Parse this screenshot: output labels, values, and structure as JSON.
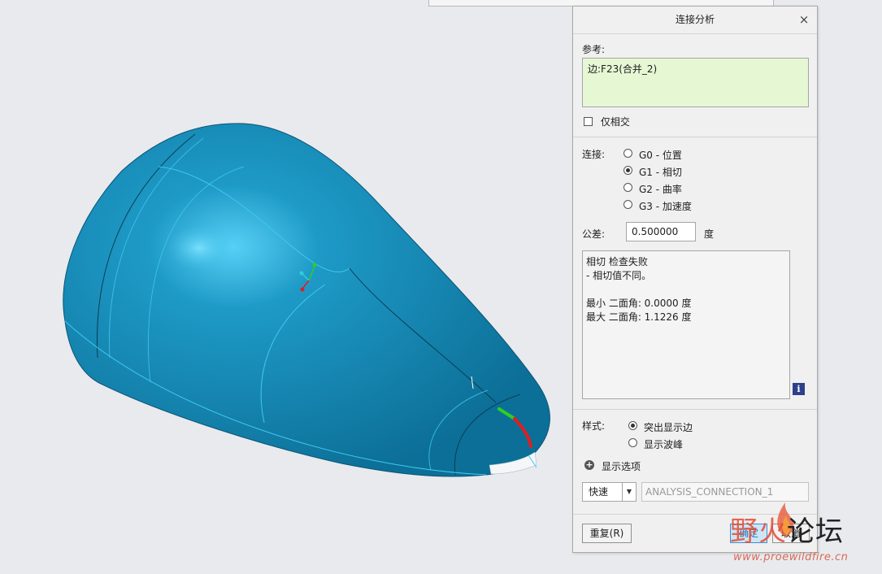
{
  "dialog": {
    "title": "连接分析",
    "close_glyph": "×",
    "reference_label": "参考:",
    "reference_value": "边:F23(合并_2)",
    "intersect_only_label": "仅相交",
    "connection_label": "连接:",
    "connection_options": [
      {
        "label": "G0 - 位置",
        "selected": false
      },
      {
        "label": "G1 - 相切",
        "selected": true
      },
      {
        "label": "G2 - 曲率",
        "selected": false
      },
      {
        "label": "G3 - 加速度",
        "selected": false
      }
    ],
    "tolerance_label": "公差:",
    "tolerance_value": "0.500000",
    "tolerance_unit": "度",
    "result_lines": [
      "相切 检查失败",
      "- 相切值不同。",
      "",
      "最小 二面角: 0.0000 度",
      "最大 二面角: 1.1226 度"
    ],
    "info_glyph": "i",
    "style_label": "样式:",
    "style_options": [
      {
        "label": "突出显示边",
        "selected": true
      },
      {
        "label": "显示波峰",
        "selected": false
      }
    ],
    "display_options_label": "显示选项",
    "mode_value": "快速",
    "analysis_name": "ANALYSIS_CONNECTION_1",
    "repeat_button": "重复(R)",
    "ok_button": "确定",
    "cancel_button": "取消"
  },
  "watermark": {
    "text_red": "野火",
    "text_dark": "论坛",
    "url": "www.proewildfire.cn"
  },
  "colors": {
    "surface": "#1388b4",
    "edge_highlight_green": "#2dcf22",
    "edge_highlight_red": "#e01f1f",
    "reference_box_bg": "#e6f7d4"
  },
  "icons": [
    "close-icon",
    "info-icon",
    "expand-plus-icon",
    "dropdown-arrow-icon",
    "coordinate-axes-icon"
  ]
}
